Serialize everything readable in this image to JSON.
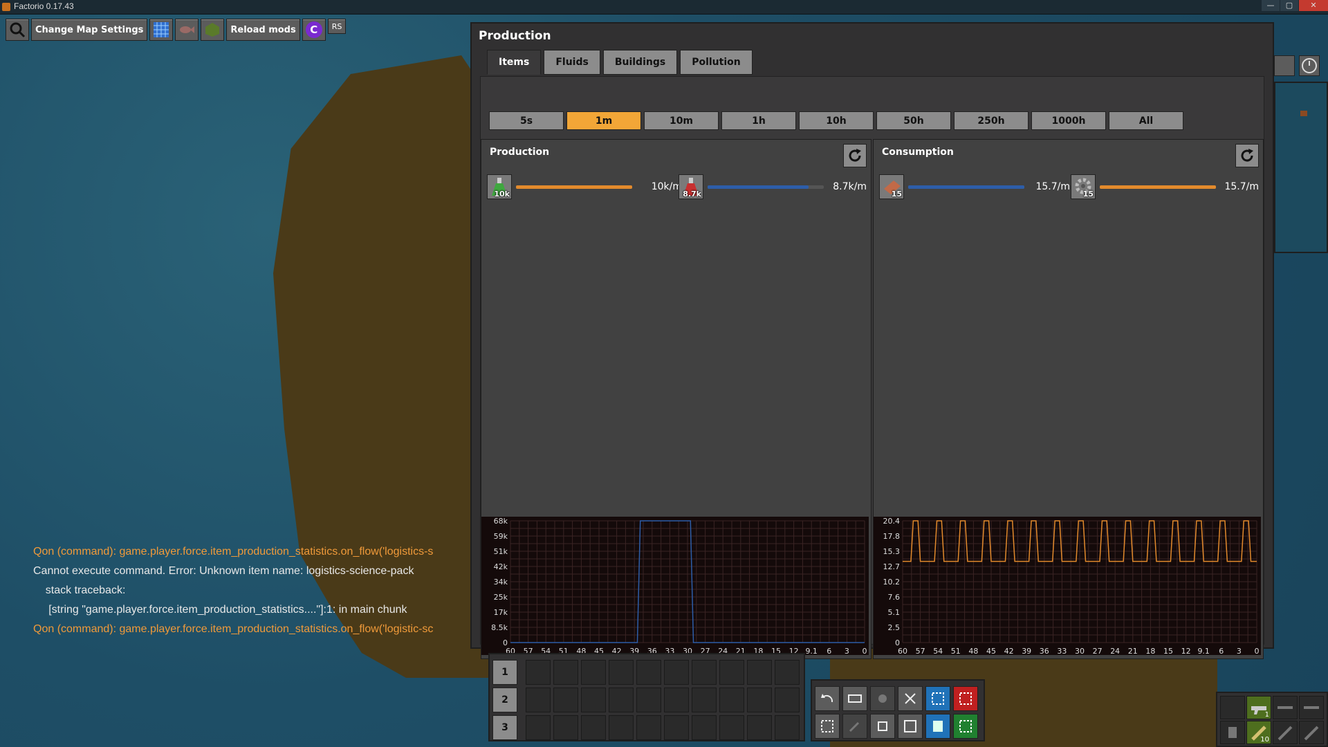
{
  "window": {
    "title": "Factorio 0.17.43",
    "minimize": "—",
    "maximize": "▢",
    "close": "✕"
  },
  "toolbar": {
    "change_map_settings": "Change Map Settings",
    "reload_mods": "Reload mods",
    "rs": "RS",
    "c_label": "C"
  },
  "production": {
    "title": "Production",
    "tabs": [
      "Items",
      "Fluids",
      "Buildings",
      "Pollution"
    ],
    "ranges": [
      "5s",
      "1m",
      "10m",
      "1h",
      "10h",
      "50h",
      "250h",
      "1000h",
      "All"
    ],
    "selected_range": "1m",
    "left": {
      "title": "Production",
      "entries": [
        {
          "icon": "automation-science-pack-icon",
          "count": "10k",
          "rate": "10k/m",
          "bar_fraction": 1.0,
          "bar_color": "#e38a2c"
        },
        {
          "icon": "logistic-science-pack-icon",
          "count": "8.7k",
          "rate": "8.7k/m",
          "bar_fraction": 0.87,
          "bar_color": "#2d5da8"
        }
      ]
    },
    "right": {
      "title": "Consumption",
      "entries": [
        {
          "icon": "copper-plate-icon",
          "count": "15",
          "rate": "15.7/m",
          "bar_fraction": 1.0,
          "bar_color": "#2d5da8"
        },
        {
          "icon": "iron-gear-wheel-icon",
          "count": "15",
          "rate": "15.7/m",
          "bar_fraction": 1.0,
          "bar_color": "#e38a2c"
        }
      ]
    }
  },
  "chart_data": [
    {
      "type": "line",
      "title": "",
      "y_ticks": [
        "68k",
        "59k",
        "51k",
        "42k",
        "34k",
        "25k",
        "17k",
        "8.5k",
        "0"
      ],
      "x_ticks": [
        "60",
        "57",
        "54",
        "51",
        "48",
        "45",
        "42",
        "39",
        "36",
        "33",
        "30",
        "27",
        "24",
        "21",
        "18",
        "15",
        "12",
        "9.1",
        "6",
        "3",
        "0"
      ],
      "ylim": [
        0,
        68000
      ],
      "xlim": [
        60,
        0
      ],
      "series": [
        {
          "name": "",
          "color": "#2d5da8",
          "x": [
            60,
            38.5,
            38,
            29.5,
            29,
            0
          ],
          "values": [
            0,
            0,
            68000,
            68000,
            0,
            0
          ]
        }
      ]
    },
    {
      "type": "line",
      "title": "",
      "y_ticks": [
        "20.4",
        "17.8",
        "15.3",
        "12.7",
        "10.2",
        "7.6",
        "5.1",
        "2.5",
        "0"
      ],
      "x_ticks": [
        "60",
        "57",
        "54",
        "51",
        "48",
        "45",
        "42",
        "39",
        "36",
        "33",
        "30",
        "27",
        "24",
        "21",
        "18",
        "15",
        "12",
        "9.1",
        "6",
        "3",
        "0"
      ],
      "ylim": [
        0,
        20.4
      ],
      "xlim": [
        60,
        0
      ],
      "series": [
        {
          "name": "",
          "color": "#e38a2c",
          "pulse_period": 4,
          "low": 13.6,
          "high": 20.4
        }
      ]
    }
  ],
  "chat": [
    {
      "kind": "o",
      "text": "Qon (command): game.player.force.item_production_statistics.on_flow('logistics-s"
    },
    {
      "kind": "w",
      "text": "Cannot execute command. Error: Unknown item name: logistics-science-pack"
    },
    {
      "kind": "w",
      "text": "    stack traceback:"
    },
    {
      "kind": "w",
      "text": "     [string \"game.player.force.item_production_statistics....\"]:1: in main chunk"
    },
    {
      "kind": "o",
      "text": "Qon (command): game.player.force.item_production_statistics.on_flow('logistic-sc"
    }
  ],
  "quickbar": {
    "rows": [
      "1",
      "2",
      "3"
    ]
  },
  "weapons": {
    "gun_count": "1",
    "ammo_count": "10"
  }
}
